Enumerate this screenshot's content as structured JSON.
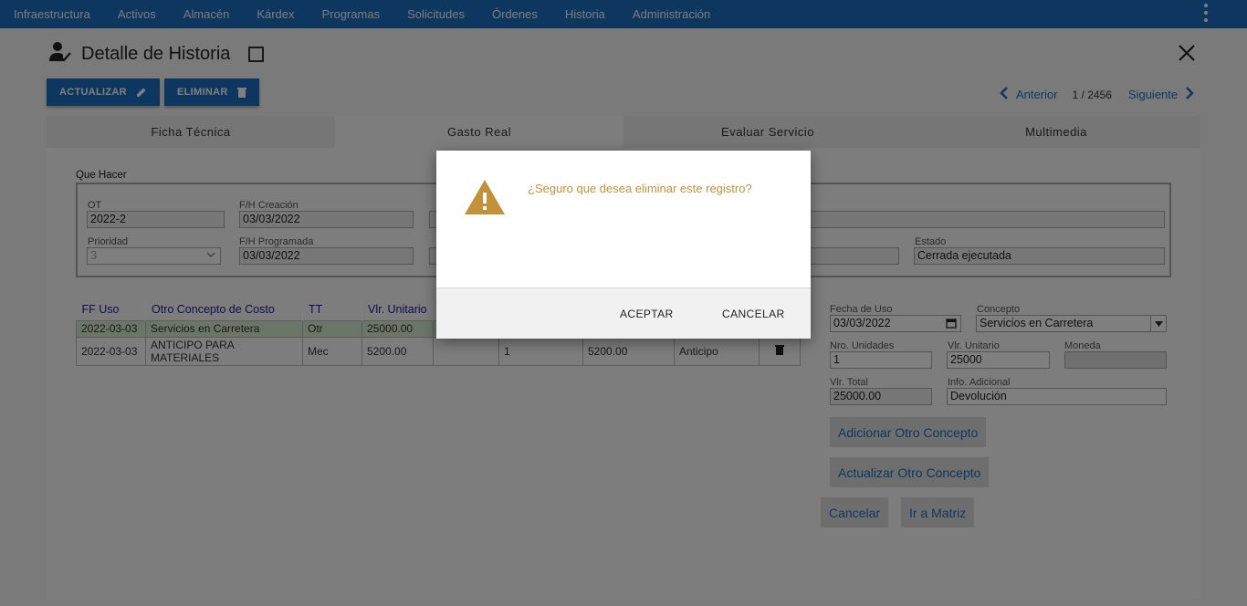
{
  "nav": {
    "items": [
      "Infraestructura",
      "Activos",
      "Almacén",
      "Kárdex",
      "Programas",
      "Solicitudes",
      "Órdenes",
      "Historia",
      "Administración"
    ]
  },
  "header": {
    "title": "Detalle de Historia"
  },
  "toolbar": {
    "update_label": "ACTUALIZAR",
    "delete_label": "ELIMINAR"
  },
  "pager": {
    "prev_label": "Anterior",
    "count": "1 / 2456",
    "next_label": "Siguiente"
  },
  "tabs": [
    {
      "label": "Ficha Técnica"
    },
    {
      "label": "Gasto Real"
    },
    {
      "label": "Evaluar Servicio"
    },
    {
      "label": "Multimedia"
    }
  ],
  "quehacer": {
    "title": "Que Hacer",
    "ot_label": "OT",
    "ot_value": "2022-2",
    "creacion_label": "F/H Creación",
    "creacion_value": "03/03/2022",
    "prioridad_label": "Prioridad",
    "prioridad_value": "3",
    "programada_label": "F/H Programada",
    "programada_value": "03/03/2022",
    "estado_label": "Estado",
    "estado_value": "Cerrada ejecutada"
  },
  "grid": {
    "headers": [
      "FF Uso",
      "Otro Concepto de Costo",
      "TT",
      "Vlr. Unitario"
    ],
    "rows": [
      [
        "2022-03-03",
        "Servicios en Carretera",
        "Otr",
        "25000.00",
        "",
        "",
        "",
        ""
      ],
      [
        "2022-03-03",
        "ANTICIPO PARA MATERIALES",
        "Mec",
        "5200.00",
        "",
        "1",
        "5200.00",
        "Anticipo"
      ]
    ]
  },
  "form": {
    "fecha_uso_label": "Fecha de Uso",
    "fecha_uso_value": "03/03/2022",
    "concepto_label": "Concepto",
    "concepto_value": "Servicios en Carretera",
    "unidades_label": "Nro. Unidades",
    "unidades_value": "1",
    "unitario_label": "Vlr. Unitario",
    "unitario_value": "25000",
    "moneda_label": "Moneda",
    "moneda_value": "",
    "total_label": "Vlr. Total",
    "total_value": "25000.00",
    "info_label": "Info. Adicional",
    "info_value": "Devolución",
    "add_label": "Adicionar Otro Concepto",
    "update_label": "Actualizar Otro Concepto",
    "cancel_label": "Cancelar",
    "matrix_label": "Ir a Matriz"
  },
  "modal": {
    "message": "¿Seguro que desea eliminar este registro?",
    "accept_label": "ACEPTAR",
    "cancel_label": "CANCELAR",
    "warning_color": "#c2913a"
  },
  "colors": {
    "primary": "#1c6fbf",
    "selected_row": "#d8ecd0"
  }
}
